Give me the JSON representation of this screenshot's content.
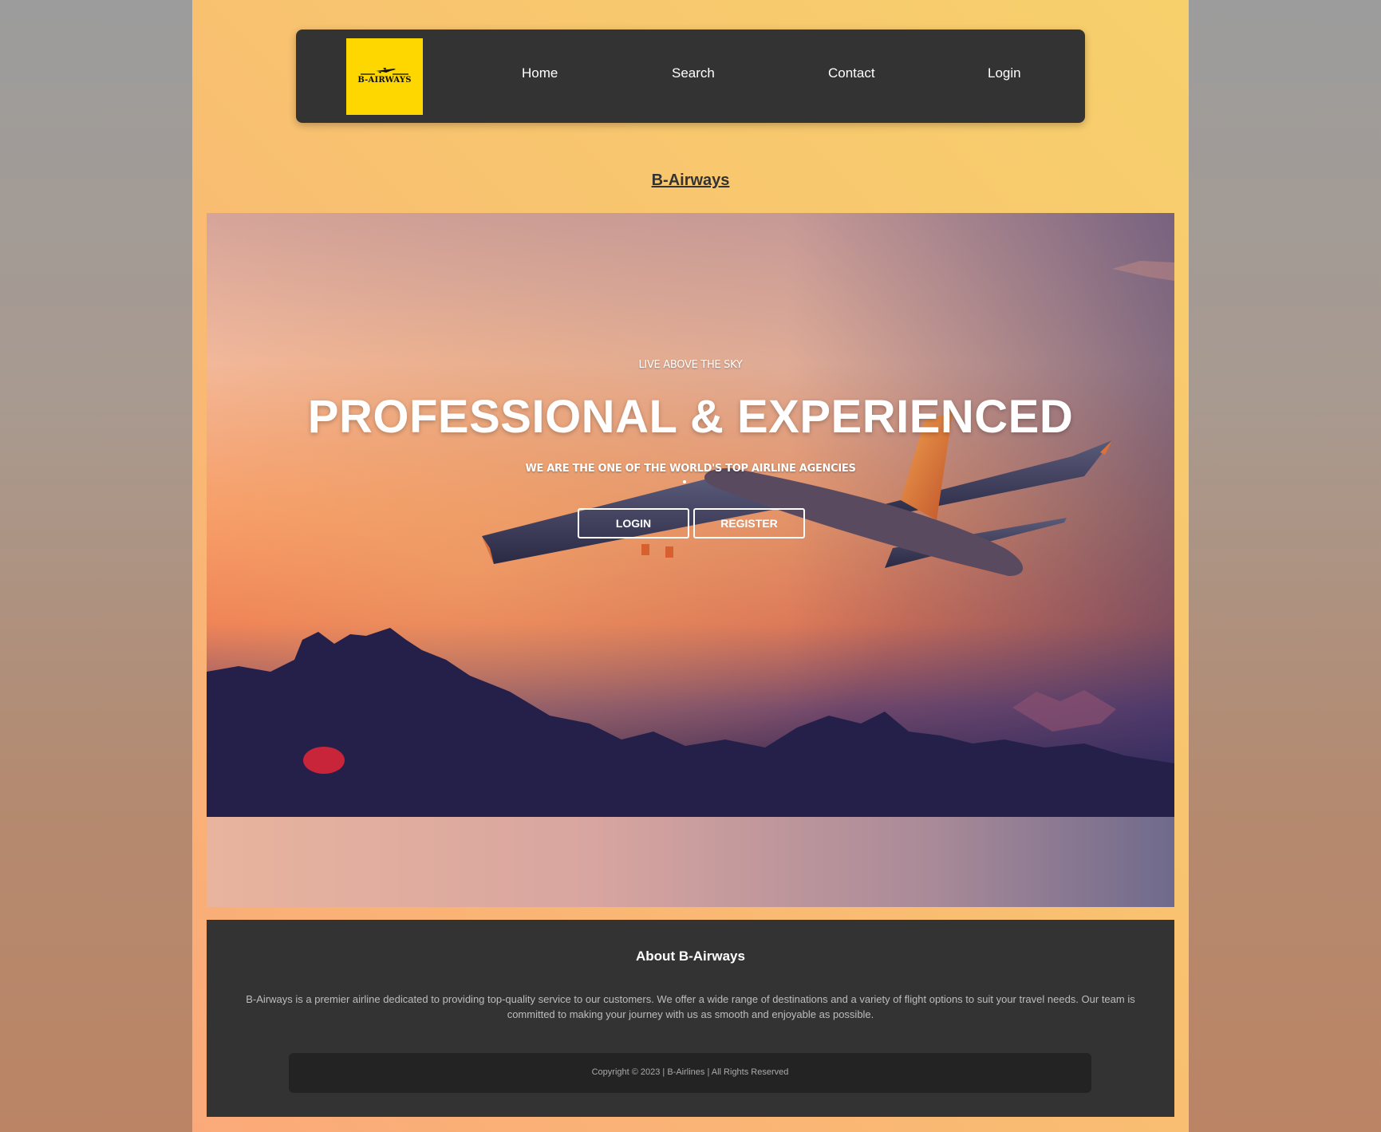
{
  "nav": {
    "logo_text": "B-AIRWAYS",
    "links": [
      {
        "label": "Home"
      },
      {
        "label": "Search"
      },
      {
        "label": "Contact"
      },
      {
        "label": "Login"
      }
    ]
  },
  "site_title": "B-Airways",
  "hero": {
    "tagline": "LIVE ABOVE THE SKY",
    "headline": "PROFESSIONAL & EXPERIENCED",
    "subhead": "WE ARE THE ONE OF THE WORLD'S TOP AIRLINE AGENCIES",
    "login_button": "LOGIN",
    "register_button": "REGISTER"
  },
  "about": {
    "title": "About B-Airways",
    "text": "B-Airways is a premier airline dedicated to providing top-quality service to our customers. We offer a wide range of destinations and a variety of flight options to suit your travel needs. Our team is committed to making your journey with us as smooth and enjoyable as possible.",
    "copyright": "Copyright © 2023 | B-Airlines | All Rights Reserved"
  },
  "colors": {
    "accent": "#ffd700",
    "nav_bg": "#333333",
    "page_gradient_start": "#f7d06c",
    "page_gradient_end": "#fba979"
  }
}
